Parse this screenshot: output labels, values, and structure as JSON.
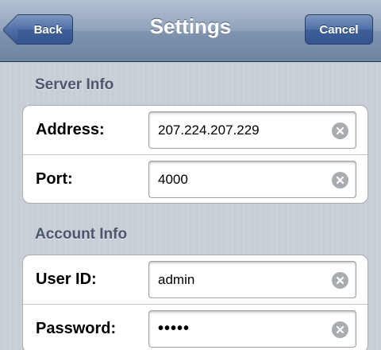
{
  "navbar": {
    "title": "Settings",
    "back_label": "Back",
    "cancel_label": "Cancel"
  },
  "sections": [
    {
      "header": "Server Info",
      "rows": [
        {
          "label": "Address:",
          "value": "207.224.207.229",
          "clear_icon": "clear-icon"
        },
        {
          "label": "Port:",
          "value": "4000",
          "clear_icon": "clear-icon"
        }
      ]
    },
    {
      "header": "Account Info",
      "rows": [
        {
          "label": "User ID:",
          "value": "admin",
          "clear_icon": "clear-icon"
        },
        {
          "label": "Password:",
          "value": "•••••",
          "clear_icon": "clear-icon"
        }
      ]
    }
  ],
  "colors": {
    "navbar": "#8fa2bb",
    "button": "#4e6fa6",
    "section_header": "#4c566c",
    "background": "#c5ccd4"
  }
}
